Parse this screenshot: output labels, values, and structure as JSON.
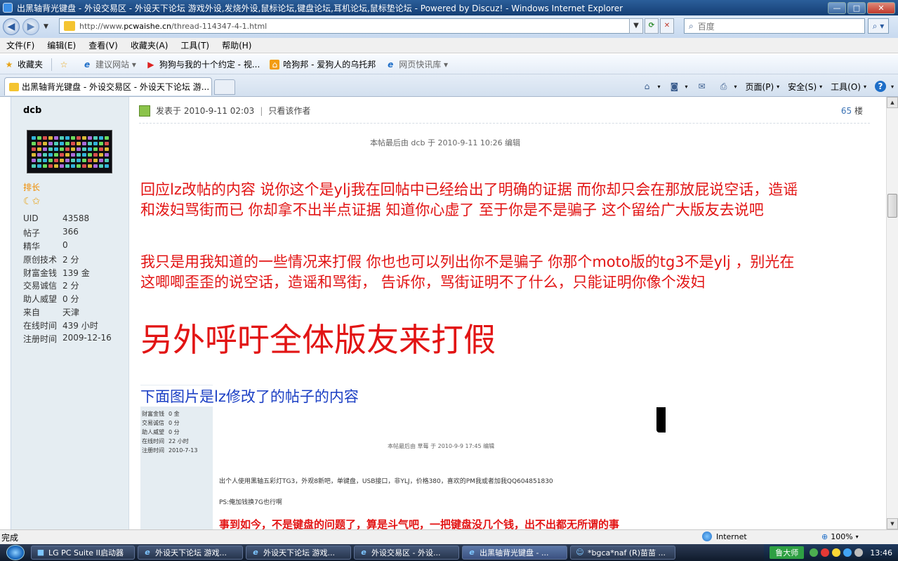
{
  "window": {
    "title": "出黑轴背光键盘 - 外设交易区 - 外设天下论坛 游戏外设,发烧外设,鼠标论坛,键盘论坛,耳机论坛,鼠标垫论坛 - Powered by Discuz! - Windows Internet Explorer",
    "min": "—",
    "max": "□",
    "close": "✕"
  },
  "address": {
    "url_prefix": "http://www.",
    "url_domain": "pcwaishe.cn",
    "url_path": "/thread-114347-4-1.html",
    "search_placeholder": "百度"
  },
  "menu": [
    "文件(F)",
    "编辑(E)",
    "查看(V)",
    "收藏夹(A)",
    "工具(T)",
    "帮助(H)"
  ],
  "favorites": {
    "label": "收藏夹",
    "suggested": "建议网站 ▾",
    "item1": "狗狗与我的十个约定 - 视...",
    "item2": "哈狗邦 - 爱狗人的乌托邦",
    "item3": "网页快讯库 ▾"
  },
  "tab": {
    "title": "出黑轴背光键盘 - 外设交易区 - 外设天下论坛 游..."
  },
  "commands": {
    "page": "页面(P)",
    "safety": "安全(S)",
    "tools": "工具(O)"
  },
  "user": {
    "name": "dcb",
    "rank": "排长",
    "stats": [
      {
        "k": "UID",
        "v": "43588"
      },
      {
        "k": "帖子",
        "v": "366"
      },
      {
        "k": "精华",
        "v": "0"
      },
      {
        "k": "原创技术",
        "v": "2 分"
      },
      {
        "k": "财富金钱",
        "v": "139 金"
      },
      {
        "k": "交易诚信",
        "v": "2 分"
      },
      {
        "k": "助人威望",
        "v": "0 分"
      },
      {
        "k": "来自",
        "v": "天津"
      },
      {
        "k": "在线时间",
        "v": "439 小时"
      },
      {
        "k": "注册时间",
        "v": "2009-12-16"
      }
    ]
  },
  "post": {
    "posted": "发表于  2010-9-11 02:03",
    "only_author": "只看该作者",
    "floor_num": "65",
    "floor_unit": "楼",
    "edit_note": "本帖最后由  dcb 于  2010-9-11 10:26 编辑",
    "para1": "回应lz改帖的内容   说你这个是ylj我在回帖中已经给出了明确的证据    而你却只会在那放屁说空话，造谣和泼妇骂街而已   你却拿不出半点证据    知道你心虚了    至于你是不是骗子  这个留给广大版友去说吧",
    "para2": "我只是用我知道的一些情况来打假    你也也可以列出你不是骗子  你那个moto版的tg3不是ylj ，别光在这唧唧歪歪的说空话，造谣和骂街，   告诉你，骂街证明不了什么，只能证明你像个泼妇",
    "big_line": "另外呼吁全体版友来打假",
    "blue_line": "下面图片是lz修改了的帖子的内容"
  },
  "shot": {
    "rows": [
      {
        "k": "财富金钱",
        "v": "0 金"
      },
      {
        "k": "交易诚信",
        "v": "0 分"
      },
      {
        "k": "助人威望",
        "v": "0 分"
      },
      {
        "k": "在线时间",
        "v": "22 小时"
      },
      {
        "k": "注册时间",
        "v": "2010-7-13"
      }
    ],
    "edit_note": "本帖最后由 草莓 于 2010-9-9 17:45 编辑",
    "line1": "出个人使用黑轴五彩灯TG3，外观8新吧，单键盘，USB接口，非YLJ，价格380，喜欢的PM我或者加我QQ604851830",
    "line2": "PS:俺加钱换7G也行啊",
    "line3": "事到如今，不是键盘的问题了，算是斗气吧，一把键盘没几个钱，出不出都无所谓的事"
  },
  "status": {
    "text": "完成",
    "zone": "Internet",
    "zoom": "100%"
  },
  "taskbar": {
    "items": [
      "LG PC Suite II启动器",
      "外设天下论坛 游戏...",
      "外设天下论坛 游戏...",
      "外设交易区 - 外设...",
      "出黑轴背光键盘 - ...",
      "*bgca*naf (R)苗苗 ..."
    ],
    "ludashi": "鲁大师",
    "clock": "13:46"
  }
}
